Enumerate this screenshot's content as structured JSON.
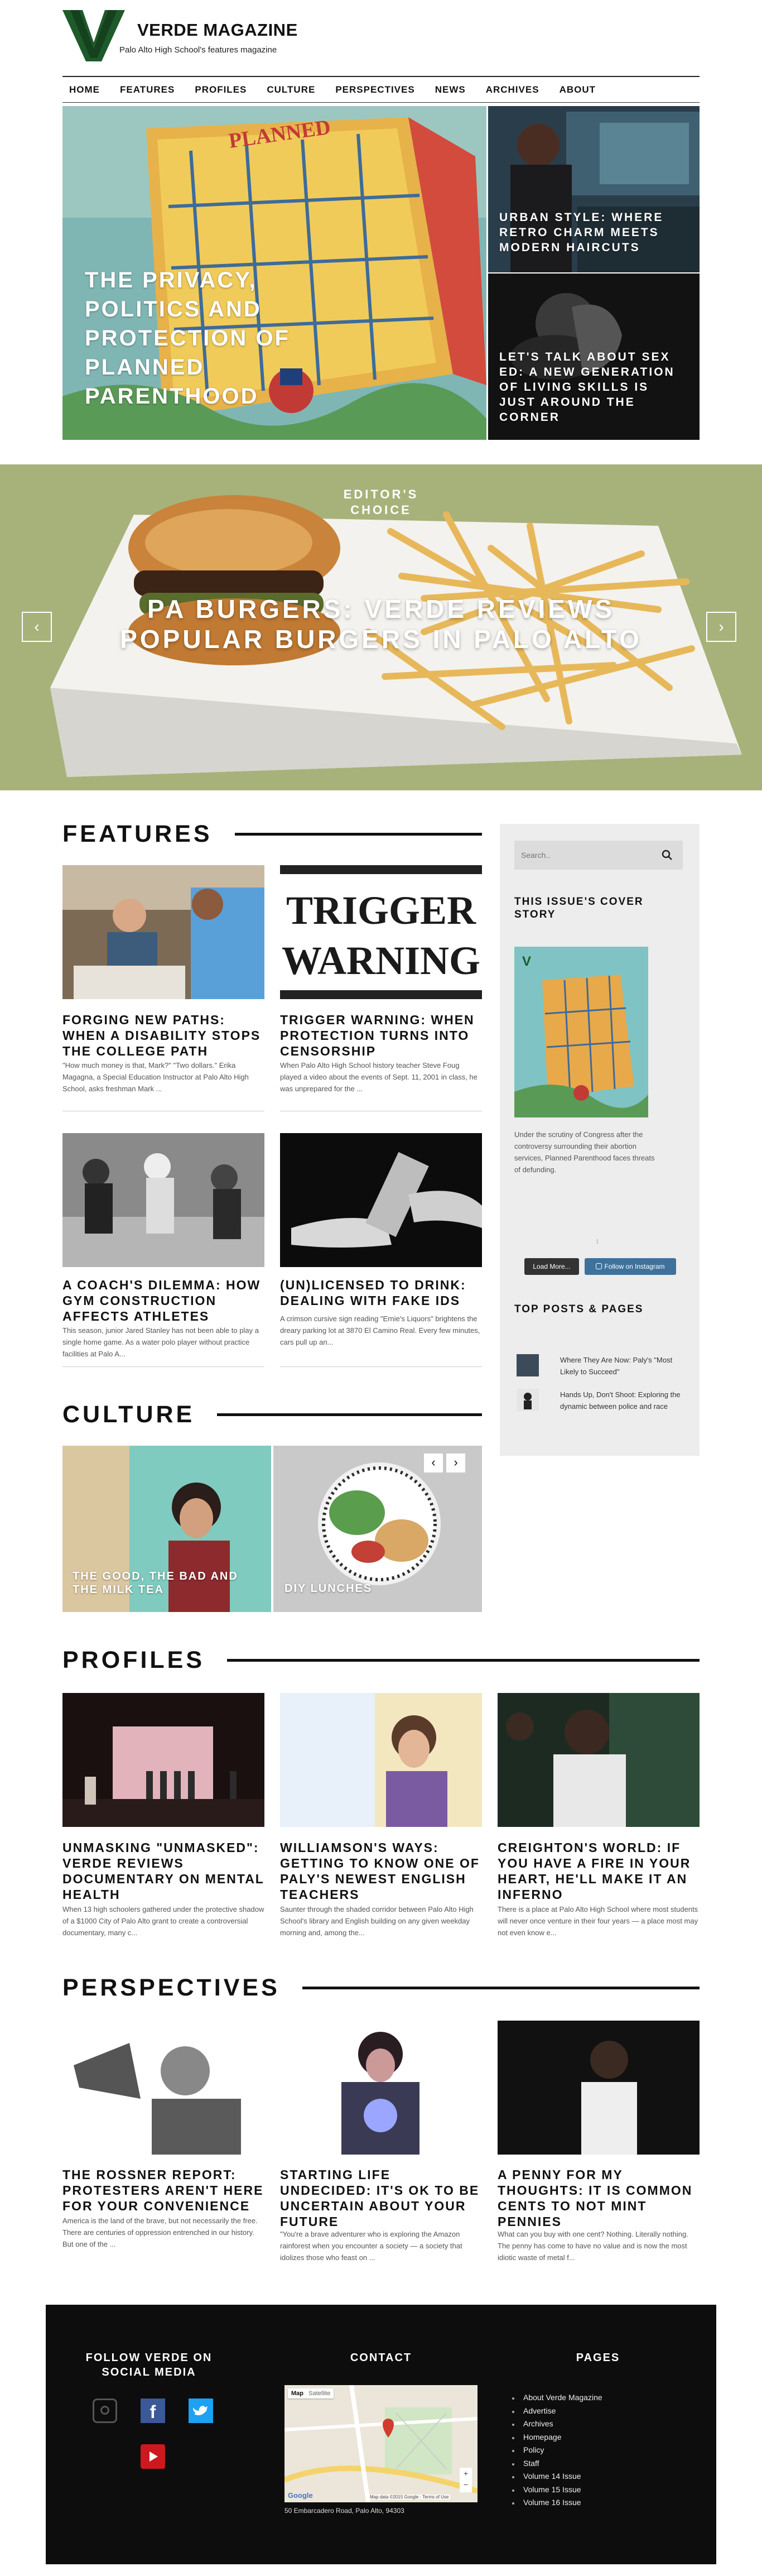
{
  "header": {
    "title": "VERDE MAGAZINE",
    "tagline": "Palo Alto High School's features magazine"
  },
  "nav": [
    "HOME",
    "FEATURES",
    "PROFILES",
    "CULTURE",
    "PERSPECTIVES",
    "NEWS",
    "ARCHIVES",
    "ABOUT"
  ],
  "hero": {
    "main_title": "THE PRIVACY, POLITICS AND PROTECTION OF PLANNED PARENTHOOD",
    "side1_title": "URBAN STYLE: WHERE RETRO CHARM MEETS MODERN HAIRCUTS",
    "side2_title": "LET'S TALK ABOUT SEX ED: A NEW GENERATION OF LIVING SKILLS IS JUST AROUND THE CORNER"
  },
  "editors_choice": {
    "label": "EDITOR'S CHOICE",
    "title": "PA BURGERS: VERDE REVIEWS POPULAR BURGERS IN PALO ALTO",
    "prev": "‹",
    "next": "›"
  },
  "features": {
    "heading": "FEATURES",
    "cards": [
      {
        "title": "FORGING NEW PATHS: WHEN A DISABILITY STOPS THE COLLEGE PATH",
        "excerpt": "\"How much money is that, Mark?\" \"Two dollars.\" Erika Magagna, a Special Education Instructor at Palo Alto High School, asks freshman Mark ..."
      },
      {
        "title": "TRIGGER WARNING: WHEN PROTECTION TURNS INTO CENSORSHIP",
        "excerpt": "When Palo Alto High School history teacher Steve Foug played a video about the events of Sept. 11, 2001 in class, he was unprepared for the ..."
      },
      {
        "title": "A COACH'S DILEMMA: HOW GYM CONSTRUCTION AFFECTS ATHLETES",
        "excerpt": "This season, junior Jared Stanley has not been able to play a single home game. As a water polo player without practice facilities at Palo A..."
      },
      {
        "title": "(UN)LICENSED TO DRINK: DEALING WITH FAKE IDS",
        "excerpt": "A crimson cursive sign reading \"Ernie's Liquors\" brightens the dreary parking lot at 3870 El Camino Real. Every few minutes, cars pull up an..."
      }
    ],
    "trigger_img_text": [
      "TRIGGER",
      "WARNING"
    ]
  },
  "culture": {
    "heading": "CULTURE",
    "items": [
      "THE GOOD, THE BAD AND THE MILK TEA",
      "DIY LUNCHES"
    ],
    "prev": "‹",
    "next": "›"
  },
  "sidebar": {
    "search_placeholder": "Search..",
    "cover_heading": "THIS ISSUE'S COVER STORY",
    "cover_text": "Under the scrutiny of Congress after the controversy surrounding their abortion services, Planned Parenthood faces threats of defunding.",
    "instagram_load": "Load More...",
    "instagram_follow": "Follow on Instagram",
    "top_heading": "TOP POSTS & PAGES",
    "top_posts": [
      "Where They Are Now: Paly's \"Most Likely to Succeed\"",
      "Hands Up, Don't Shoot: Exploring the dynamic between police and race"
    ]
  },
  "profiles": {
    "heading": "PROFILES",
    "cards": [
      {
        "title": "UNMASKING \"UNMASKED\": VERDE REVIEWS DOCUMENTARY ON MENTAL HEALTH",
        "excerpt": "When 13 high schoolers gathered under the protective shadow of a $1000 City of Palo Alto grant to create a controversial documentary, many c..."
      },
      {
        "title": "WILLIAMSON'S WAYS: GETTING TO KNOW ONE OF PALY'S NEWEST ENGLISH TEACHERS",
        "excerpt": "Saunter through the shaded corridor between Palo Alto High School's library and English building on any given weekday morning and, among the..."
      },
      {
        "title": "CREIGHTON'S WORLD: IF YOU HAVE A FIRE IN YOUR HEART, HE'LL MAKE IT AN INFERNO",
        "excerpt": "There is a place at Palo Alto High School where most students will never once venture in their four years — a place most may not even know e..."
      }
    ]
  },
  "perspectives": {
    "heading": "PERSPECTIVES",
    "cards": [
      {
        "title": "THE ROSSNER REPORT: PROTESTERS AREN'T HERE FOR YOUR CONVENIENCE",
        "excerpt": "America is the land of the brave, but not necessarily the free. There are centuries of oppression entrenched in our history. But one of the ..."
      },
      {
        "title": "STARTING LIFE UNDECIDED: IT'S OK TO BE UNCERTAIN ABOUT YOUR FUTURE",
        "excerpt": "\"You're a brave adventurer who is exploring the Amazon rainforest when you encounter a society — a society that idolizes those who feast on ..."
      },
      {
        "title": "A PENNY FOR MY THOUGHTS: IT IS COMMON CENTS TO NOT MINT PENNIES",
        "excerpt": "What can you buy with one cent? Nothing. Literally nothing. The penny has come to have no value and is now the most idiotic waste of metal f..."
      }
    ]
  },
  "footer": {
    "follow_heading": "FOLLOW VERDE ON SOCIAL MEDIA",
    "contact_heading": "CONTACT",
    "pages_heading": "PAGES",
    "address": "50 Embarcadero Road, Palo Alto, 94303",
    "map_tab_map": "Map",
    "map_tab_sat": "Satellite",
    "map_google": "Google",
    "map_attrib": "Map data ©2015 Google · Terms of Use",
    "pages": [
      "About Verde Magazine",
      "Advertise",
      "Archives",
      "Homepage",
      "Policy",
      "Staff",
      "Volume 14 Issue",
      "Volume 15 Issue",
      "Volume 16 Issue"
    ]
  },
  "colors": {
    "brand_green": "#1e5a2a",
    "editors_bg": "#a7b27b",
    "footer_bg": "#0d0d0d",
    "instagram_blue": "#3f729b",
    "facebook_blue": "#3b5998",
    "twitter_blue": "#1da1f2",
    "youtube_red": "#cc181e"
  }
}
